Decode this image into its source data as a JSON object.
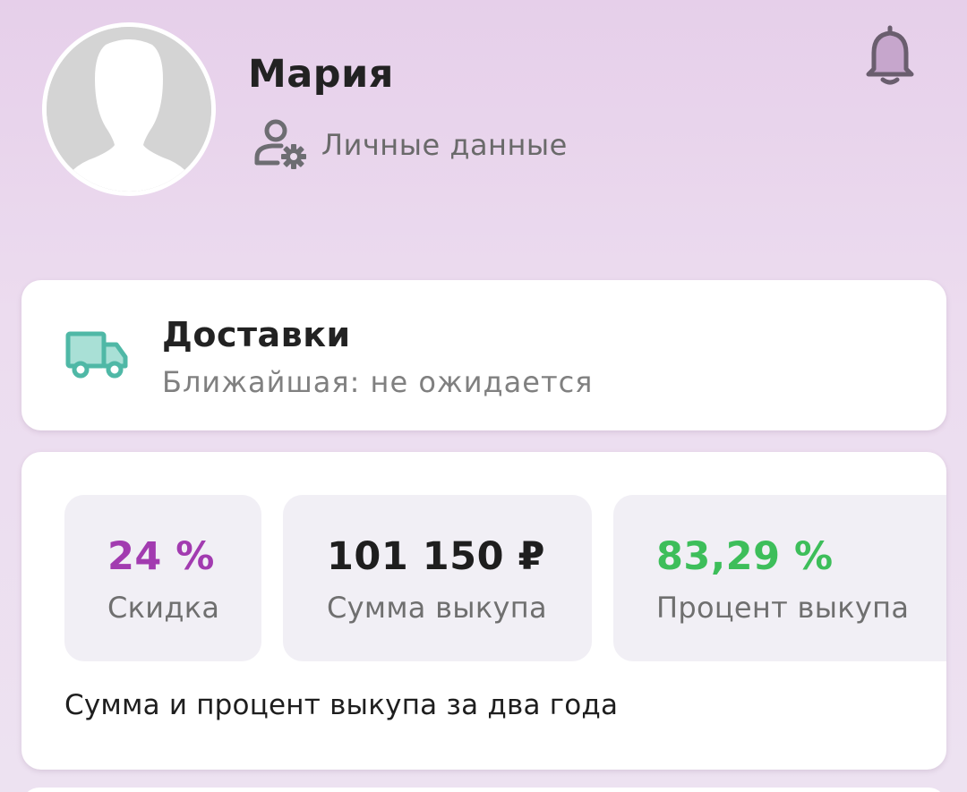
{
  "profile": {
    "name": "Мария",
    "personal_data_label": "Личные данные",
    "avatar_icon": "user-silhouette-icon",
    "personal_data_icon": "user-settings-icon",
    "notifications_icon": "bell-icon"
  },
  "delivery": {
    "icon": "truck-icon",
    "title": "Доставки",
    "subtitle": "Ближайшая: не ожидается"
  },
  "stats": {
    "discount": {
      "value": "24 %",
      "label": "Скидка",
      "color": "#a23bb0"
    },
    "purchase_sum": {
      "value": "101 150 ₽",
      "label": "Сумма выкупа",
      "color": "#1e1e1e"
    },
    "purchase_percent": {
      "value": "83,29 %",
      "label": "Процент выкупа",
      "color": "#3dbe5a"
    },
    "note": "Сумма и процент выкупа за два года"
  },
  "colors": {
    "background_top": "#e6cfea",
    "background_bottom": "#ede2f1",
    "truck_accent": "#4fb8a6",
    "tile_background": "#f1eff5"
  }
}
